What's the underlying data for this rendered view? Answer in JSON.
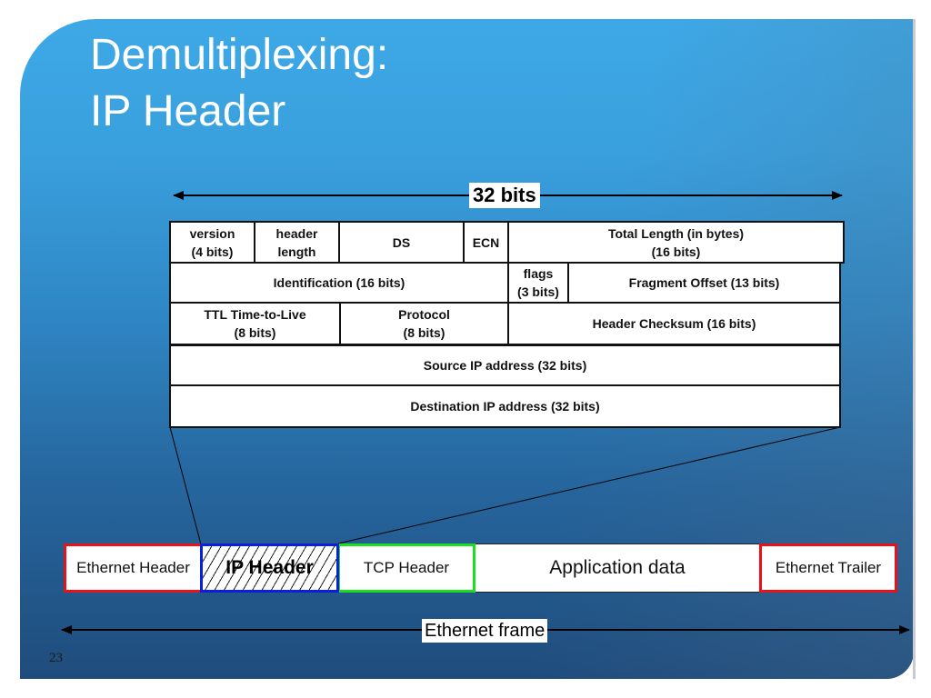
{
  "slide": {
    "title_lines": [
      "Demultiplexing:",
      "IP Header"
    ],
    "page_number": "23"
  },
  "diagram": {
    "width_label": "32 bits",
    "ip_header_rows": [
      [
        {
          "label": "version\n(4 bits)"
        },
        {
          "label": "header\nlength"
        },
        {
          "label": "DS"
        },
        {
          "label": "ECN"
        },
        {
          "label": "Total Length (in bytes)\n(16 bits)"
        }
      ],
      [
        {
          "label": "Identification (16 bits)"
        },
        {
          "label": "flags\n(3 bits)"
        },
        {
          "label": "Fragment Offset (13 bits)"
        }
      ],
      [
        {
          "label": "TTL Time-to-Live\n(8 bits)"
        },
        {
          "label": "Protocol\n(8 bits)"
        },
        {
          "label": "Header Checksum (16 bits)"
        }
      ],
      [
        {
          "label": "Source IP address (32 bits)"
        }
      ],
      [
        {
          "label": "Destination IP address (32 bits)"
        }
      ]
    ],
    "frame_segments": [
      {
        "label": "Ethernet Header",
        "border_color": "#e8121a"
      },
      {
        "label": "IP Header",
        "border_color": "#0a1ee0",
        "hatched": true
      },
      {
        "label": "TCP Header",
        "border_color": "#19e01e"
      },
      {
        "label": "Application data",
        "border_color": "#222222"
      },
      {
        "label": "Ethernet Trailer",
        "border_color": "#e8121a"
      }
    ],
    "frame_label": "Ethernet frame"
  }
}
